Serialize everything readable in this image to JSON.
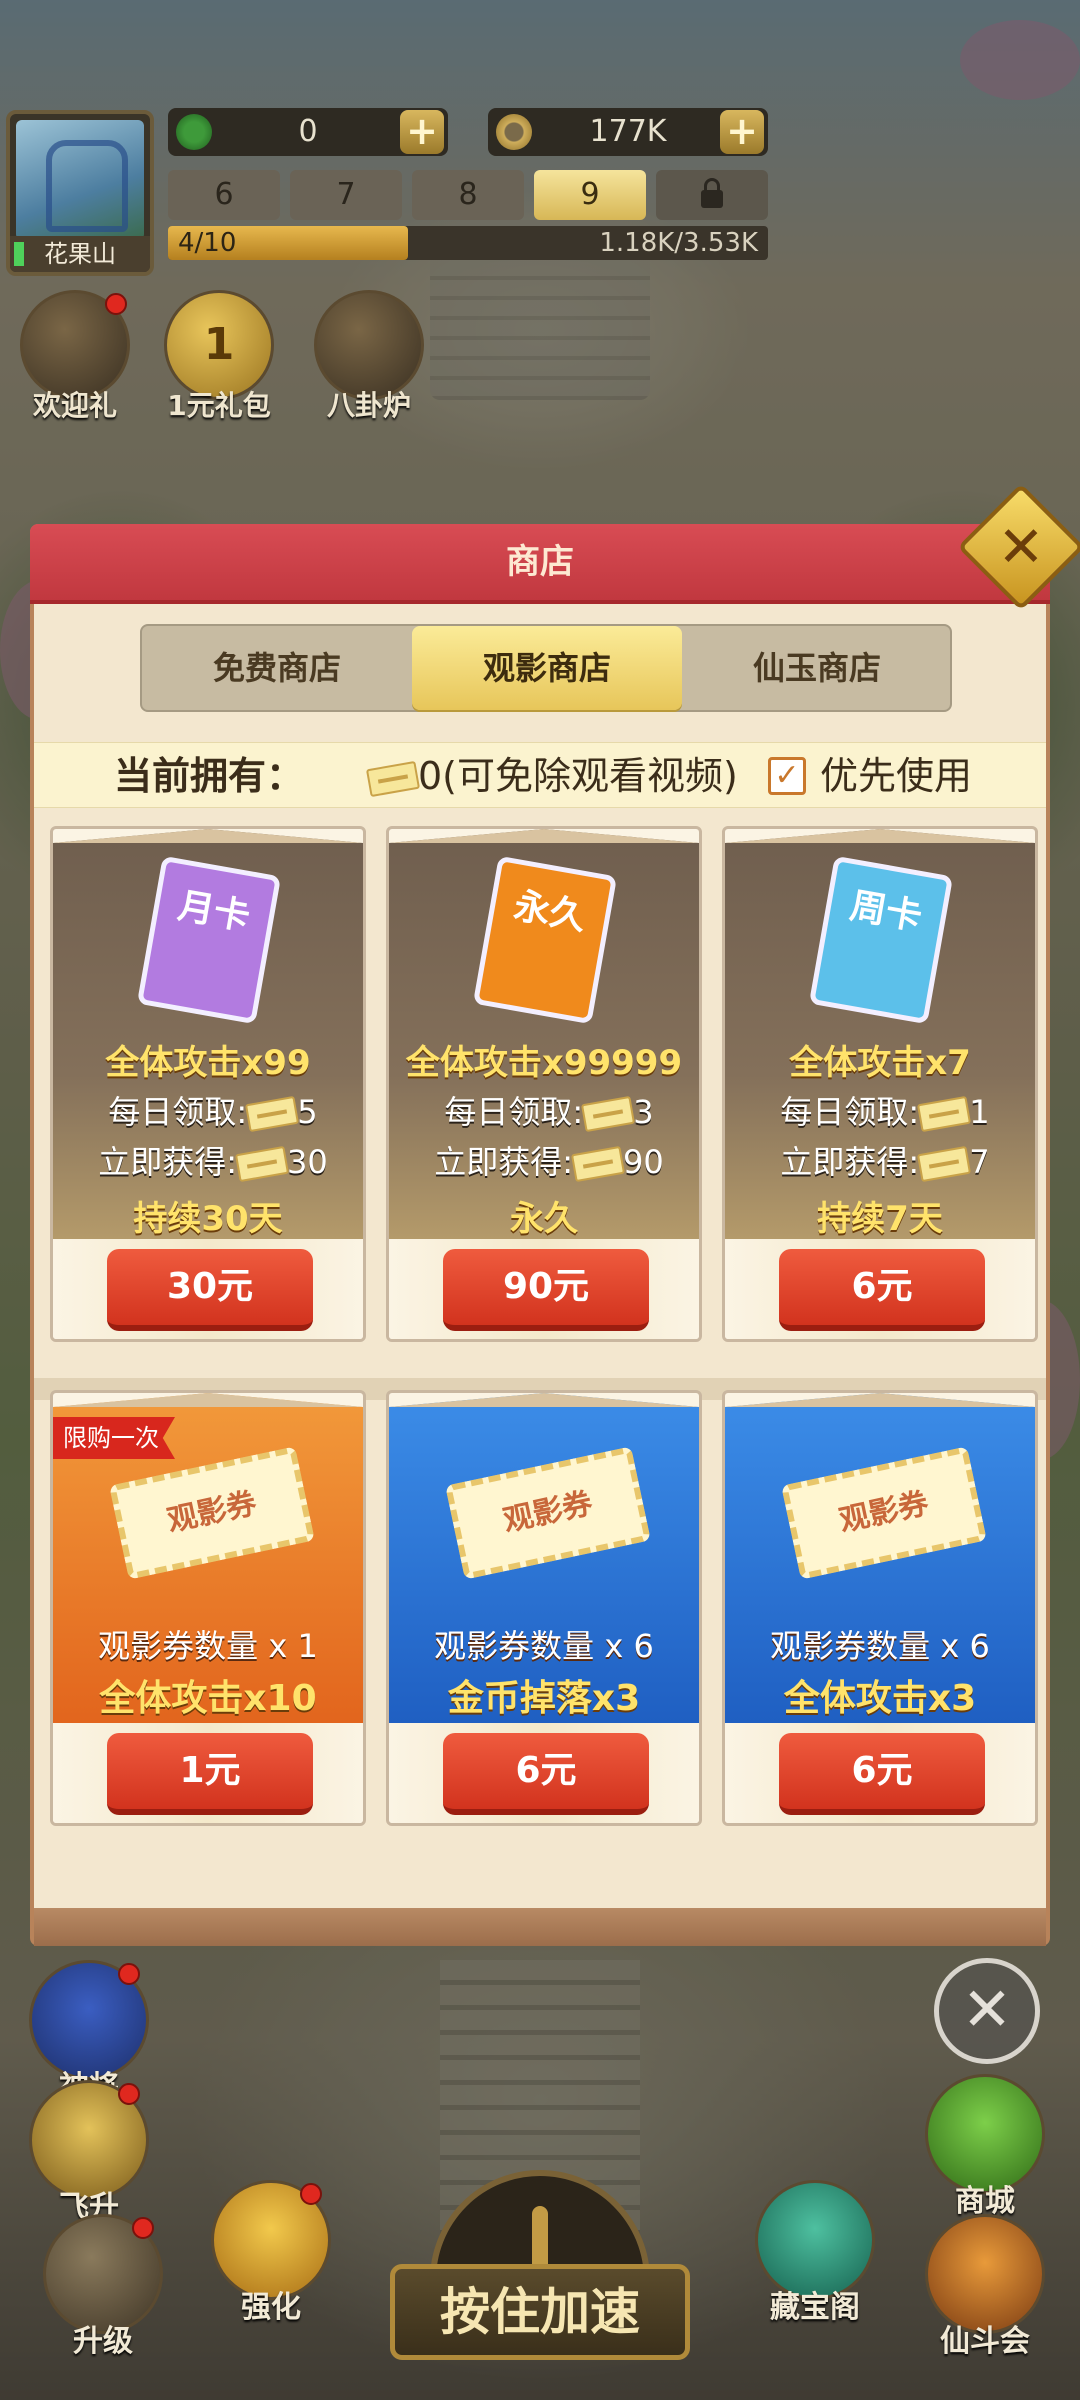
{
  "hud": {
    "avatar_name": "花果山",
    "jade": "0",
    "coins": "177K",
    "plus": "+",
    "levels": [
      "6",
      "7",
      "8",
      "9"
    ],
    "active_level": "9",
    "progress_label": "4/10",
    "progress_fraction": 0.4,
    "power": "1.18K/3.53K",
    "top_buttons": [
      {
        "label": "欢迎礼",
        "icon": "tv-icon"
      },
      {
        "label": "1元礼包",
        "icon": "coin-icon",
        "glyph": "1"
      },
      {
        "label": "八卦炉",
        "icon": "furnace-icon"
      }
    ]
  },
  "shop": {
    "title": "商店",
    "close_glyph": "✕",
    "tabs": [
      "免费商店",
      "观影商店",
      "仙玉商店"
    ],
    "active_tab": "观影商店",
    "owned_label": "当前拥有：",
    "owned_value": "0(可免除观看视频)",
    "priority_label": "优先使用",
    "priority_checked": true,
    "check_glyph": "✓",
    "subscriptions": [
      {
        "card_text": "月卡",
        "card_color": "#b27be0",
        "headline": "全体攻击x99",
        "daily_label": "每日领取:",
        "daily": "5",
        "instant_label": "立即获得:",
        "instant": "30",
        "duration": "持续30天",
        "price": "30元"
      },
      {
        "card_text": "永久",
        "card_color": "#f08a1c",
        "headline": "全体攻击x99999",
        "daily_label": "每日领取:",
        "daily": "3",
        "instant_label": "立即获得:",
        "instant": "90",
        "duration": "永久",
        "price": "90元"
      },
      {
        "card_text": "周卡",
        "card_color": "#5cc0ea",
        "headline": "全体攻击x7",
        "daily_label": "每日领取:",
        "daily": "1",
        "instant_label": "立即获得:",
        "instant": "7",
        "duration": "持续7天",
        "price": "6元"
      }
    ],
    "tickets": [
      {
        "limit_tag": "限购一次",
        "ticket_text": "观影券",
        "quantity": "观影券数量 x 1",
        "bonus": "全体攻击x10",
        "price": "1元",
        "theme": "orange"
      },
      {
        "ticket_text": "观影券",
        "quantity": "观影券数量 x 6",
        "bonus": "金币掉落x3",
        "price": "6元",
        "theme": "blue"
      },
      {
        "ticket_text": "观影券",
        "quantity": "观影券数量 x 6",
        "bonus": "全体攻击x3",
        "price": "6元",
        "theme": "blue"
      }
    ]
  },
  "bottom": {
    "left_buttons": [
      "神将",
      "飞升",
      "升级",
      "强化"
    ],
    "right_buttons": [
      "商城",
      "藏宝阁",
      "仙斗会"
    ],
    "speed_button": "按住加速",
    "skip_glyph": "✕"
  }
}
